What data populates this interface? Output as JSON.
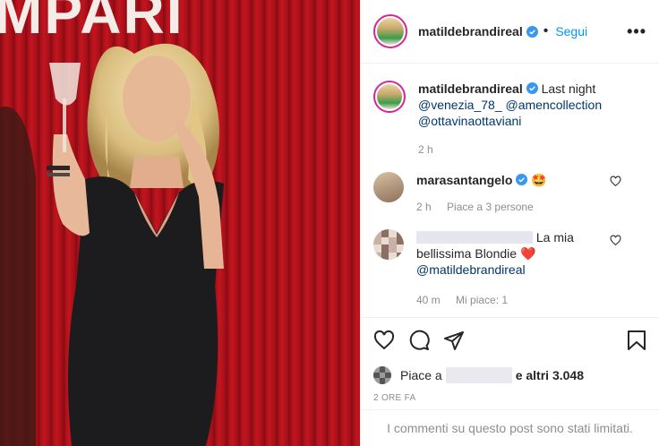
{
  "photo": {
    "brand_text": "MPARI"
  },
  "header": {
    "username": "matildebrandireal",
    "follow_label": "Segui",
    "more_label": "•••"
  },
  "caption": {
    "username": "matildebrandireal",
    "text": "Last night",
    "mentions": [
      "@venezia_78_",
      "@amencollection",
      "@ottavinaottaviani"
    ],
    "time": "2 h"
  },
  "comments": [
    {
      "username": "marasantangelo",
      "text": "🤩",
      "time": "2 h",
      "likes": "Piace a 3 persone"
    },
    {
      "text": "La mia bellissima Blondie",
      "emoji": "❤️",
      "mention": "@matildebrandireal",
      "time": "40 m",
      "likes": "Mi piace: 1"
    }
  ],
  "actions": {
    "likes_prefix": "Piace a",
    "likes_suffix": "e altri 3.048",
    "timestamp": "2 ORE FA"
  },
  "footer": {
    "limited_text": "I commenti su questo post sono stati limitati."
  },
  "colors": {
    "accent": "#0095f6",
    "verified": "#3897f0",
    "photo_red": "#b3121c",
    "heart": "#ed4956"
  }
}
